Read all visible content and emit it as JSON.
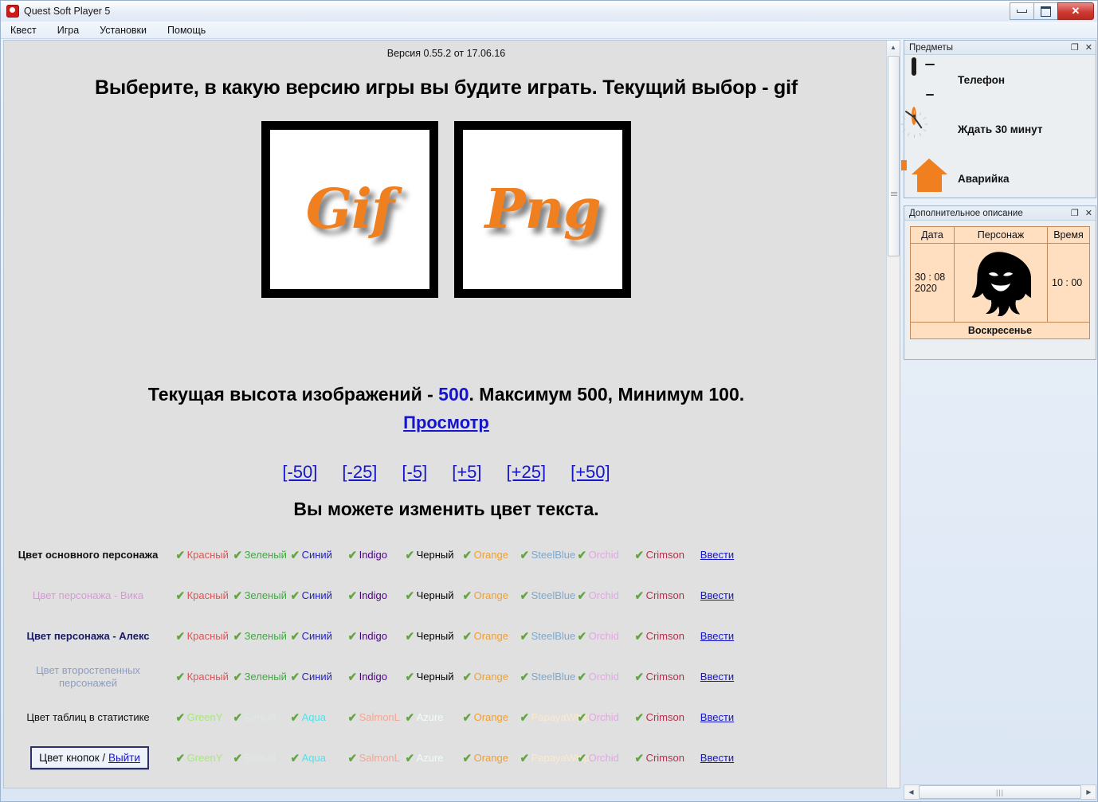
{
  "window": {
    "title": "Quest Soft Player 5",
    "buttons": {
      "minimize": "minimize-icon",
      "maximize": "maximize-icon",
      "close": "✕"
    }
  },
  "menubar": {
    "items": [
      "Квест",
      "Игра",
      "Установки",
      "Помощь"
    ]
  },
  "main": {
    "version": "Версия 0.55.2 от 17.06.16",
    "headline": "Выберите, в какую версию игры вы будите играть. Текущий выбор - gif",
    "images": [
      {
        "name": "gif-image-button",
        "word": "Gif"
      },
      {
        "name": "png-image-button",
        "word": "Png"
      }
    ],
    "height_line": {
      "prefix": "Текущая высота изображений - ",
      "value": "500",
      "suffix": ". Максимум 500, Минимум 100."
    },
    "view_link": "Просмотр",
    "steps": [
      "[-50]",
      "[-25]",
      "[-5]",
      "[+5]",
      "[+25]",
      "[+50]"
    ],
    "subhead": "Вы можете изменить цвет текста.",
    "enter_label": "Ввести",
    "exit_button": {
      "prefix": "Цвет кнопок / ",
      "link": "Выйти"
    },
    "palette_a": [
      {
        "label": "Красный",
        "color": "#dd5555"
      },
      {
        "label": "Зеленый",
        "color": "#3faa3f"
      },
      {
        "label": "Синий",
        "color": "#2222bb"
      },
      {
        "label": "Indigo",
        "color": "#4b0082"
      },
      {
        "label": "Черный",
        "color": "#000000"
      },
      {
        "label": "Orange",
        "color": "#f0a030"
      },
      {
        "label": "SteelBlue",
        "color": "#7fa8c9"
      },
      {
        "label": "Orchid",
        "color": "#e2a8e2"
      },
      {
        "label": "Crimson",
        "color": "#b5304c"
      }
    ],
    "palette_b": [
      {
        "label": "GreenY",
        "color": "#a8e77a"
      },
      {
        "label": "Белый",
        "color": "#dfe7e7"
      },
      {
        "label": "Aqua",
        "color": "#4fe3e8"
      },
      {
        "label": "SalmonL",
        "color": "#f3a694"
      },
      {
        "label": "Azure",
        "color": "#f0fbfb"
      },
      {
        "label": "Orange",
        "color": "#f0a030"
      },
      {
        "label": "PapayaWhip",
        "color": "#fbe9cf"
      },
      {
        "label": "Orchid",
        "color": "#e2a8e2"
      },
      {
        "label": "Crimson",
        "color": "#b5304c"
      }
    ],
    "rows": [
      {
        "label": "Цвет основного персонажа",
        "label_color": "#101010",
        "bold": true,
        "palette": "a"
      },
      {
        "label": "Цвет персонажа - Вика",
        "label_color": "#d49ad4",
        "bold": false,
        "palette": "a"
      },
      {
        "label": "Цвет персонажа - Алекс",
        "label_color": "#1a1a66",
        "bold": true,
        "palette": "a"
      },
      {
        "label": "Цвет второстепенных\nперсонажей",
        "label_color": "#8c9ec4",
        "bold": false,
        "palette": "a"
      },
      {
        "label": "Цвет таблиц в статистике",
        "label_color": "#101010",
        "bold": false,
        "palette": "b"
      }
    ],
    "tick_icon": "check-icon",
    "tick_glyph": "✔"
  },
  "dock": {
    "items_panel": {
      "title": "Предметы",
      "items": [
        {
          "label": "Телефон",
          "icon": "phone-icon"
        },
        {
          "label": "Ждать 30 минут",
          "icon": "clock-icon"
        },
        {
          "label": "Аварийка",
          "icon": "house-icon"
        }
      ]
    },
    "desc_panel": {
      "title": "Дополнительное описание",
      "headers": [
        "Дата",
        "Персонаж",
        "Время"
      ],
      "date": "30 : 08\n2020",
      "time": "10 : 00",
      "character_icon": "ghost-icon",
      "day": "Воскресенье"
    },
    "panel_buttons": {
      "restore": "❐",
      "close": "✕"
    }
  },
  "scrollbars": {
    "vertical": {
      "up": "▲",
      "down": "▼"
    },
    "horizontal": {
      "left": "◀",
      "right": "▶",
      "grip": "|||"
    }
  },
  "theme": {
    "accent_orange": "#ef7f1f",
    "link_blue": "#1515cc",
    "tick_green": "#63a63f"
  }
}
